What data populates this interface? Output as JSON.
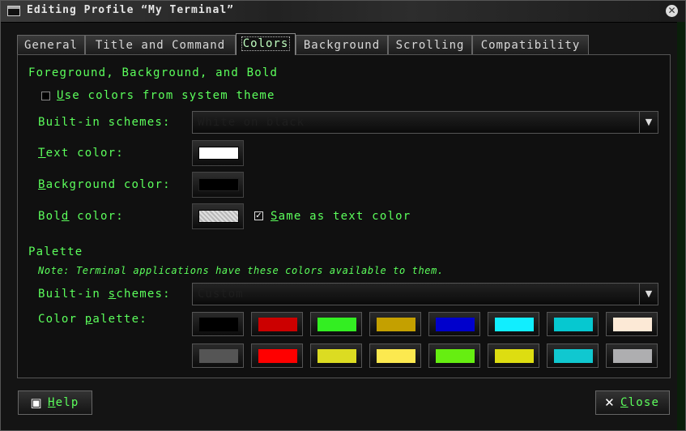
{
  "window": {
    "title": "Editing Profile “My Terminal”"
  },
  "tabs": [
    {
      "label": "General"
    },
    {
      "label": "Title and Command"
    },
    {
      "label": "Colors"
    },
    {
      "label": "Background"
    },
    {
      "label": "Scrolling"
    },
    {
      "label": "Compatibility"
    }
  ],
  "active_tab": "Colors",
  "fg_section": {
    "heading": "Foreground, Background, and Bold",
    "use_system_theme": {
      "label_rest": "se colors from system theme",
      "mnemonic": "U",
      "checked": false
    },
    "builtin_schemes_label": "Built-in schemes:",
    "builtin_schemes_value": "White on black",
    "text_color": {
      "label_rest": "ext color:",
      "mnemonic": "T",
      "color": "#ffffff"
    },
    "background_color": {
      "label_rest": "ackground color:",
      "mnemonic": "B",
      "color": "#000000"
    },
    "bold_color": {
      "label_pre": "Bol",
      "mnemonic": "d",
      "label_post": " color:",
      "color": "#d9d9d9"
    },
    "same_as_text": {
      "label_rest": "ame as text color",
      "mnemonic": "S",
      "checked": true
    }
  },
  "palette_section": {
    "heading": "Palette",
    "note": "Note: Terminal applications have these colors available to them.",
    "builtin_schemes_label_pre": "Built-in ",
    "builtin_schemes_mnemonic": "s",
    "builtin_schemes_label_post": "chemes:",
    "builtin_schemes_value": "Custom",
    "color_palette_label_pre": "Color ",
    "color_palette_mnemonic": "p",
    "color_palette_label_post": "alette:",
    "row1": [
      "#000000",
      "#cc0000",
      "#33ee22",
      "#c4a000",
      "#0000cc",
      "#11eeff",
      "#06c8d0",
      "#fce9d6"
    ],
    "row2": [
      "#555555",
      "#ff0000",
      "#dcdc22",
      "#fce94f",
      "#66ee11",
      "#dddd11",
      "#10c8d0",
      "#aeaeb0"
    ]
  },
  "buttons": {
    "help": {
      "mnemonic": "H",
      "rest": "elp",
      "icon": "help-icon"
    },
    "close": {
      "mnemonic": "C",
      "rest": "lose",
      "icon": "close-icon"
    }
  }
}
